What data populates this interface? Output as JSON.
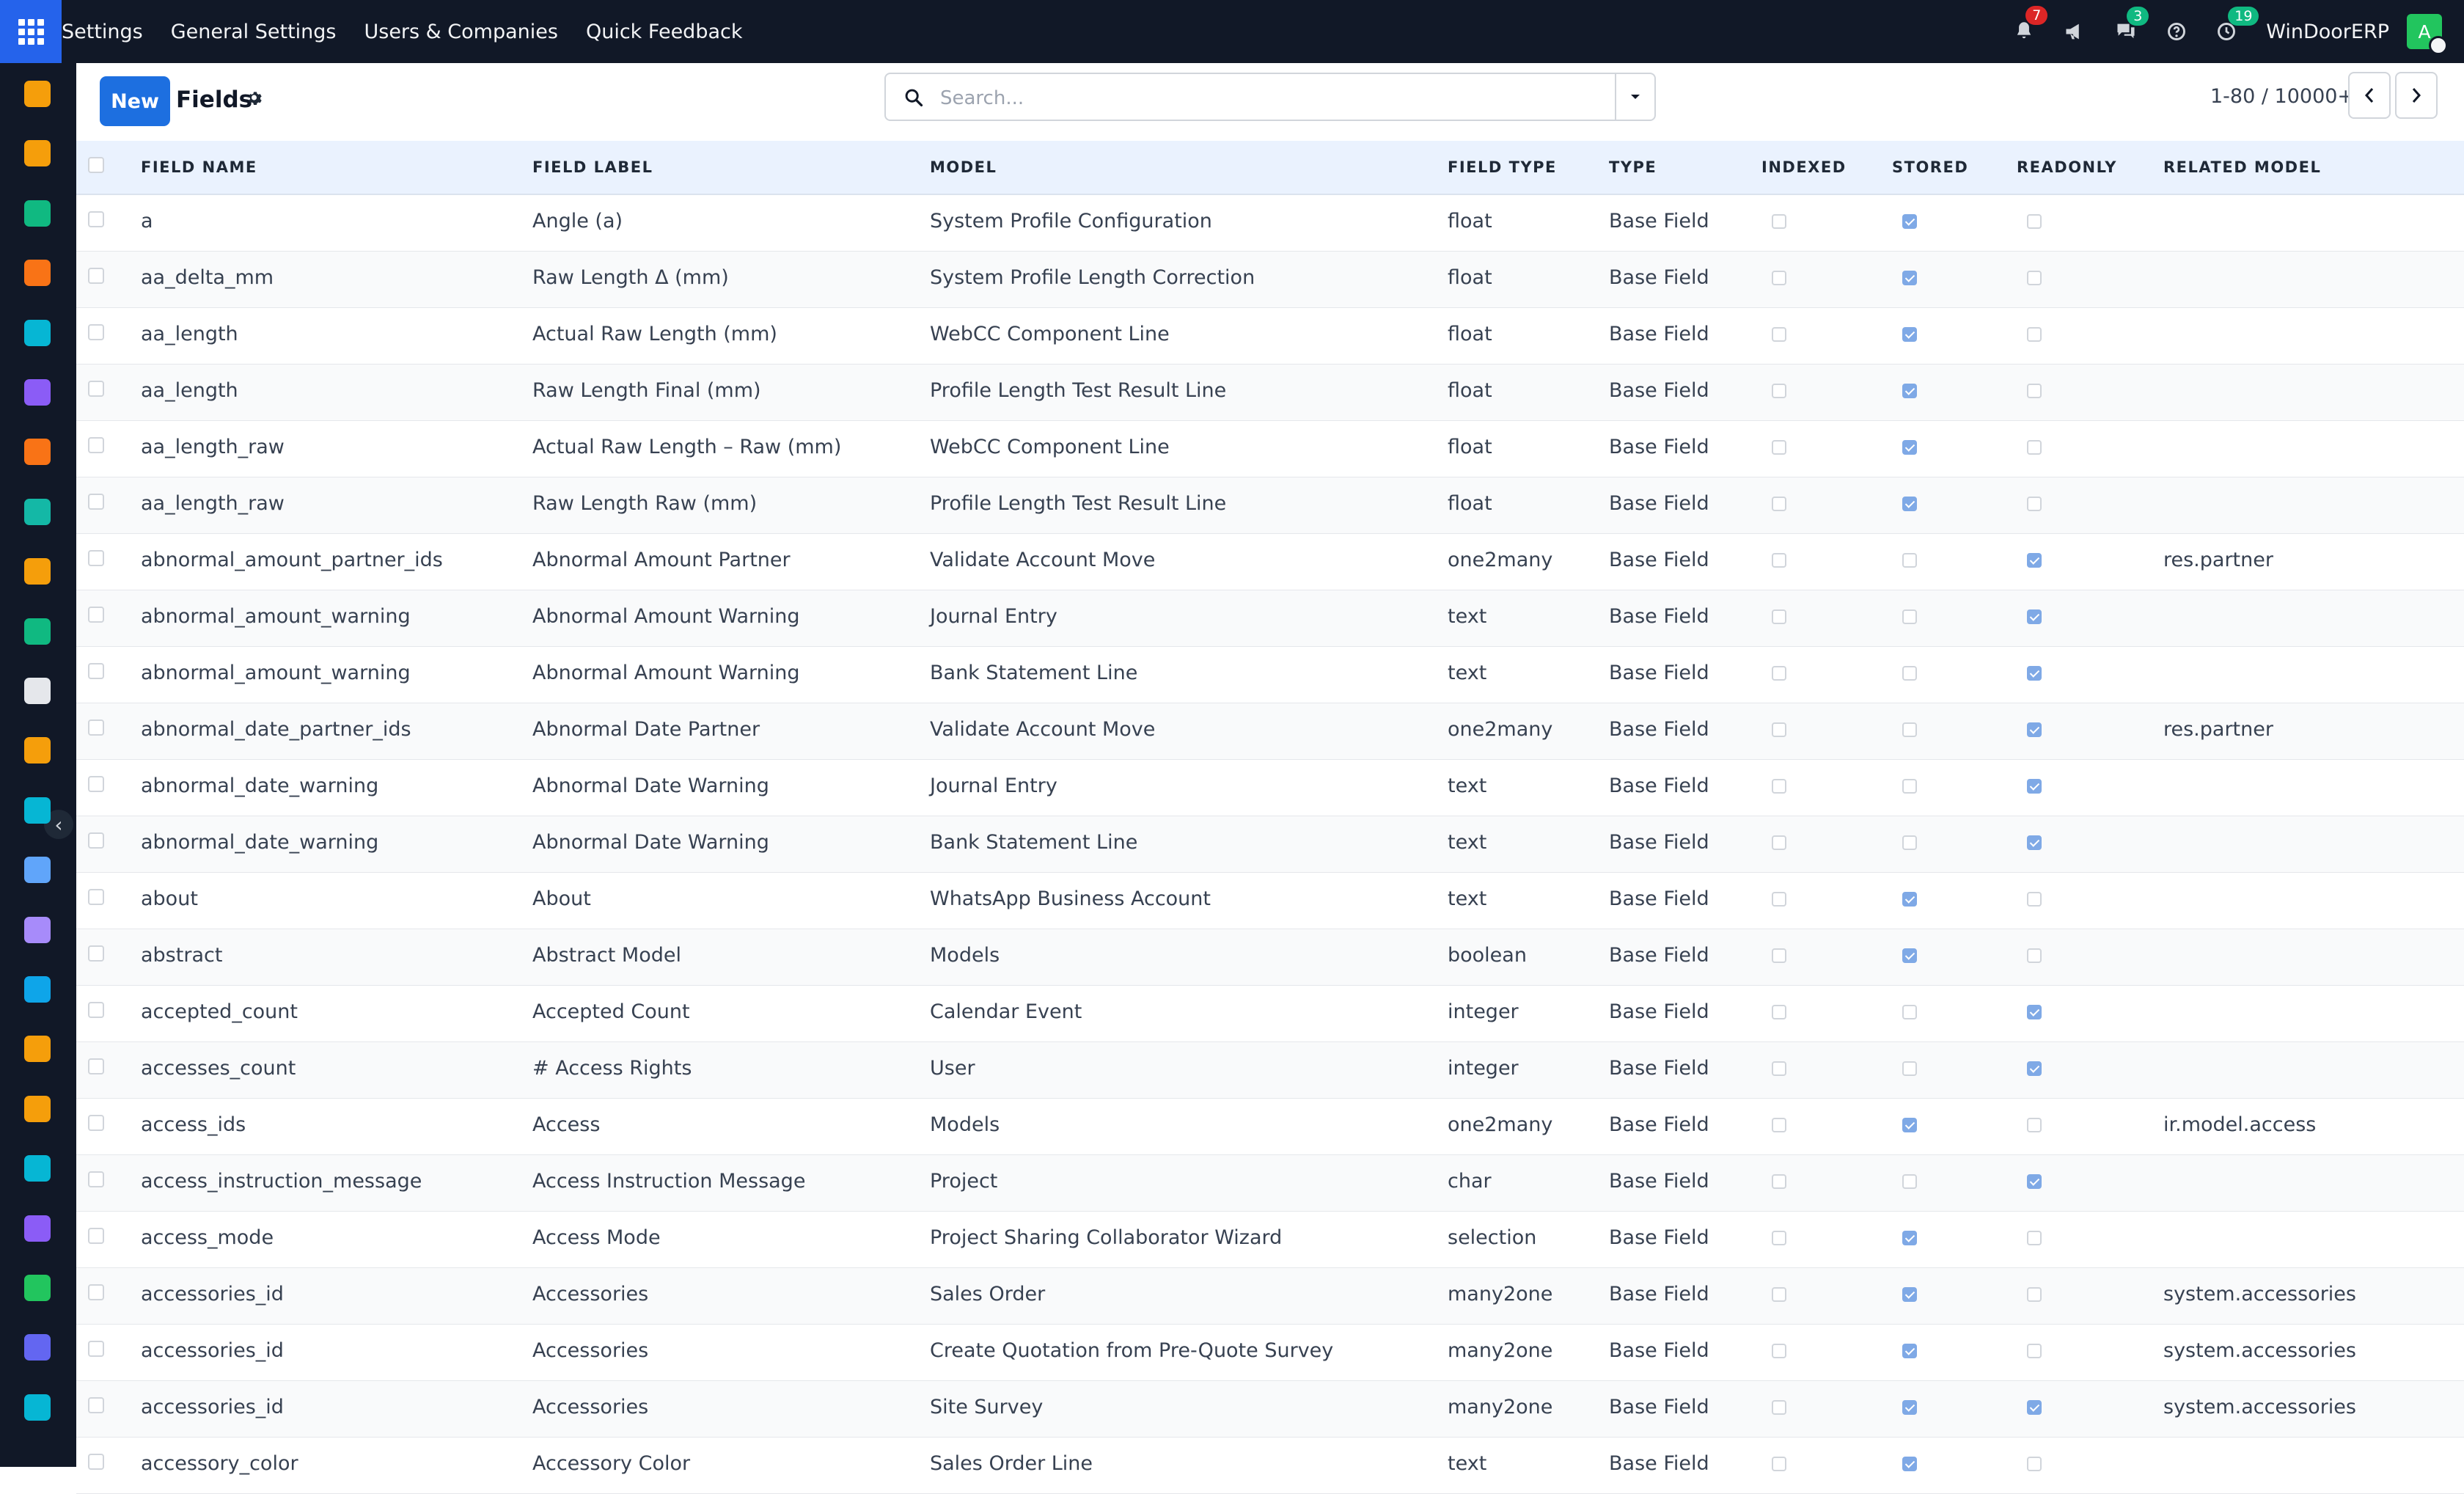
{
  "navbar": {
    "menu": [
      "Settings",
      "General Settings",
      "Users & Companies",
      "Quick Feedback"
    ],
    "notifications_count": "7",
    "messages_count": "3",
    "activities_count": "19",
    "company_name": "WinDoorERP",
    "avatar_letter": "A"
  },
  "sidebar_apps": [
    {
      "icon": "dashboard-app-icon",
      "color": "#f59e0b"
    },
    {
      "icon": "palette-app-icon",
      "color": "#f59e0b"
    },
    {
      "icon": "contacts-app-icon",
      "color": "#10b981"
    },
    {
      "icon": "discuss-app-icon",
      "color": "#f97316"
    },
    {
      "icon": "wave-app-icon",
      "color": "#06b6d4"
    },
    {
      "icon": "mail-app-icon",
      "color": "#8b5cf6"
    },
    {
      "icon": "livechat-app-icon",
      "color": "#f97316"
    },
    {
      "icon": "accounting-app-icon",
      "color": "#14b8a6"
    },
    {
      "icon": "reporting-app-icon",
      "color": "#f59e0b"
    },
    {
      "icon": "employees-app-icon",
      "color": "#10b981"
    },
    {
      "icon": "inventory-app-icon",
      "color": "#e5e7eb"
    },
    {
      "icon": "website-app-icon",
      "color": "#f59e0b"
    },
    {
      "icon": "todo-app-icon",
      "color": "#06b6d4"
    },
    {
      "icon": "knowledge-app-icon",
      "color": "#60a5fa"
    },
    {
      "icon": "apps-store-icon",
      "color": "#a78bfa"
    },
    {
      "icon": "invoicing-app-icon",
      "color": "#0ea5e9"
    },
    {
      "icon": "team-app-icon",
      "color": "#f59e0b"
    },
    {
      "icon": "calendar-app-icon",
      "color": "#f59e0b"
    },
    {
      "icon": "sign-app-icon",
      "color": "#06b6d4"
    },
    {
      "icon": "dashboards-app-icon",
      "color": "#8b5cf6"
    },
    {
      "icon": "whatsapp-app-icon",
      "color": "#22c55e"
    },
    {
      "icon": "clock-app-icon",
      "color": "#6366f1"
    },
    {
      "icon": "wave2-app-icon",
      "color": "#06b6d4"
    }
  ],
  "control_panel": {
    "new_label": "New",
    "title": "Fields",
    "search_placeholder": "Search...",
    "pager": "1-80 / 10000+"
  },
  "table": {
    "headers": [
      "FIELD NAME",
      "FIELD LABEL",
      "MODEL",
      "FIELD TYPE",
      "TYPE",
      "INDEXED",
      "STORED",
      "READONLY",
      "RELATED MODEL"
    ],
    "rows": [
      {
        "field_name": "a",
        "field_label": "Angle (a)",
        "model": "System Profile Configuration",
        "field_type": "float",
        "type": "Base Field",
        "indexed": false,
        "stored": true,
        "readonly": false,
        "related_model": ""
      },
      {
        "field_name": "aa_delta_mm",
        "field_label": "Raw Length Δ (mm)",
        "model": "System Profile Length Correction",
        "field_type": "float",
        "type": "Base Field",
        "indexed": false,
        "stored": true,
        "readonly": false,
        "related_model": ""
      },
      {
        "field_name": "aa_length",
        "field_label": "Actual Raw Length (mm)",
        "model": "WebCC Component Line",
        "field_type": "float",
        "type": "Base Field",
        "indexed": false,
        "stored": true,
        "readonly": false,
        "related_model": ""
      },
      {
        "field_name": "aa_length",
        "field_label": "Raw Length Final (mm)",
        "model": "Profile Length Test Result Line",
        "field_type": "float",
        "type": "Base Field",
        "indexed": false,
        "stored": true,
        "readonly": false,
        "related_model": ""
      },
      {
        "field_name": "aa_length_raw",
        "field_label": "Actual Raw Length – Raw (mm)",
        "model": "WebCC Component Line",
        "field_type": "float",
        "type": "Base Field",
        "indexed": false,
        "stored": true,
        "readonly": false,
        "related_model": ""
      },
      {
        "field_name": "aa_length_raw",
        "field_label": "Raw Length Raw (mm)",
        "model": "Profile Length Test Result Line",
        "field_type": "float",
        "type": "Base Field",
        "indexed": false,
        "stored": true,
        "readonly": false,
        "related_model": ""
      },
      {
        "field_name": "abnormal_amount_partner_ids",
        "field_label": "Abnormal Amount Partner",
        "model": "Validate Account Move",
        "field_type": "one2many",
        "type": "Base Field",
        "indexed": false,
        "stored": false,
        "readonly": true,
        "related_model": "res.partner"
      },
      {
        "field_name": "abnormal_amount_warning",
        "field_label": "Abnormal Amount Warning",
        "model": "Journal Entry",
        "field_type": "text",
        "type": "Base Field",
        "indexed": false,
        "stored": false,
        "readonly": true,
        "related_model": ""
      },
      {
        "field_name": "abnormal_amount_warning",
        "field_label": "Abnormal Amount Warning",
        "model": "Bank Statement Line",
        "field_type": "text",
        "type": "Base Field",
        "indexed": false,
        "stored": false,
        "readonly": true,
        "related_model": ""
      },
      {
        "field_name": "abnormal_date_partner_ids",
        "field_label": "Abnormal Date Partner",
        "model": "Validate Account Move",
        "field_type": "one2many",
        "type": "Base Field",
        "indexed": false,
        "stored": false,
        "readonly": true,
        "related_model": "res.partner"
      },
      {
        "field_name": "abnormal_date_warning",
        "field_label": "Abnormal Date Warning",
        "model": "Journal Entry",
        "field_type": "text",
        "type": "Base Field",
        "indexed": false,
        "stored": false,
        "readonly": true,
        "related_model": ""
      },
      {
        "field_name": "abnormal_date_warning",
        "field_label": "Abnormal Date Warning",
        "model": "Bank Statement Line",
        "field_type": "text",
        "type": "Base Field",
        "indexed": false,
        "stored": false,
        "readonly": true,
        "related_model": ""
      },
      {
        "field_name": "about",
        "field_label": "About",
        "model": "WhatsApp Business Account",
        "field_type": "text",
        "type": "Base Field",
        "indexed": false,
        "stored": true,
        "readonly": false,
        "related_model": ""
      },
      {
        "field_name": "abstract",
        "field_label": "Abstract Model",
        "model": "Models",
        "field_type": "boolean",
        "type": "Base Field",
        "indexed": false,
        "stored": true,
        "readonly": false,
        "related_model": ""
      },
      {
        "field_name": "accepted_count",
        "field_label": "Accepted Count",
        "model": "Calendar Event",
        "field_type": "integer",
        "type": "Base Field",
        "indexed": false,
        "stored": false,
        "readonly": true,
        "related_model": ""
      },
      {
        "field_name": "accesses_count",
        "field_label": "# Access Rights",
        "model": "User",
        "field_type": "integer",
        "type": "Base Field",
        "indexed": false,
        "stored": false,
        "readonly": true,
        "related_model": ""
      },
      {
        "field_name": "access_ids",
        "field_label": "Access",
        "model": "Models",
        "field_type": "one2many",
        "type": "Base Field",
        "indexed": false,
        "stored": true,
        "readonly": false,
        "related_model": "ir.model.access"
      },
      {
        "field_name": "access_instruction_message",
        "field_label": "Access Instruction Message",
        "model": "Project",
        "field_type": "char",
        "type": "Base Field",
        "indexed": false,
        "stored": false,
        "readonly": true,
        "related_model": ""
      },
      {
        "field_name": "access_mode",
        "field_label": "Access Mode",
        "model": "Project Sharing Collaborator Wizard",
        "field_type": "selection",
        "type": "Base Field",
        "indexed": false,
        "stored": true,
        "readonly": false,
        "related_model": ""
      },
      {
        "field_name": "accessories_id",
        "field_label": "Accessories",
        "model": "Sales Order",
        "field_type": "many2one",
        "type": "Base Field",
        "indexed": false,
        "stored": true,
        "readonly": false,
        "related_model": "system.accessories"
      },
      {
        "field_name": "accessories_id",
        "field_label": "Accessories",
        "model": "Create Quotation from Pre-Quote Survey",
        "field_type": "many2one",
        "type": "Base Field",
        "indexed": false,
        "stored": true,
        "readonly": false,
        "related_model": "system.accessories"
      },
      {
        "field_name": "accessories_id",
        "field_label": "Accessories",
        "model": "Site Survey",
        "field_type": "many2one",
        "type": "Base Field",
        "indexed": false,
        "stored": true,
        "readonly": true,
        "related_model": "system.accessories"
      },
      {
        "field_name": "accessory_color",
        "field_label": "Accessory Color",
        "model": "Sales Order Line",
        "field_type": "text",
        "type": "Base Field",
        "indexed": false,
        "stored": true,
        "readonly": false,
        "related_model": ""
      }
    ]
  }
}
